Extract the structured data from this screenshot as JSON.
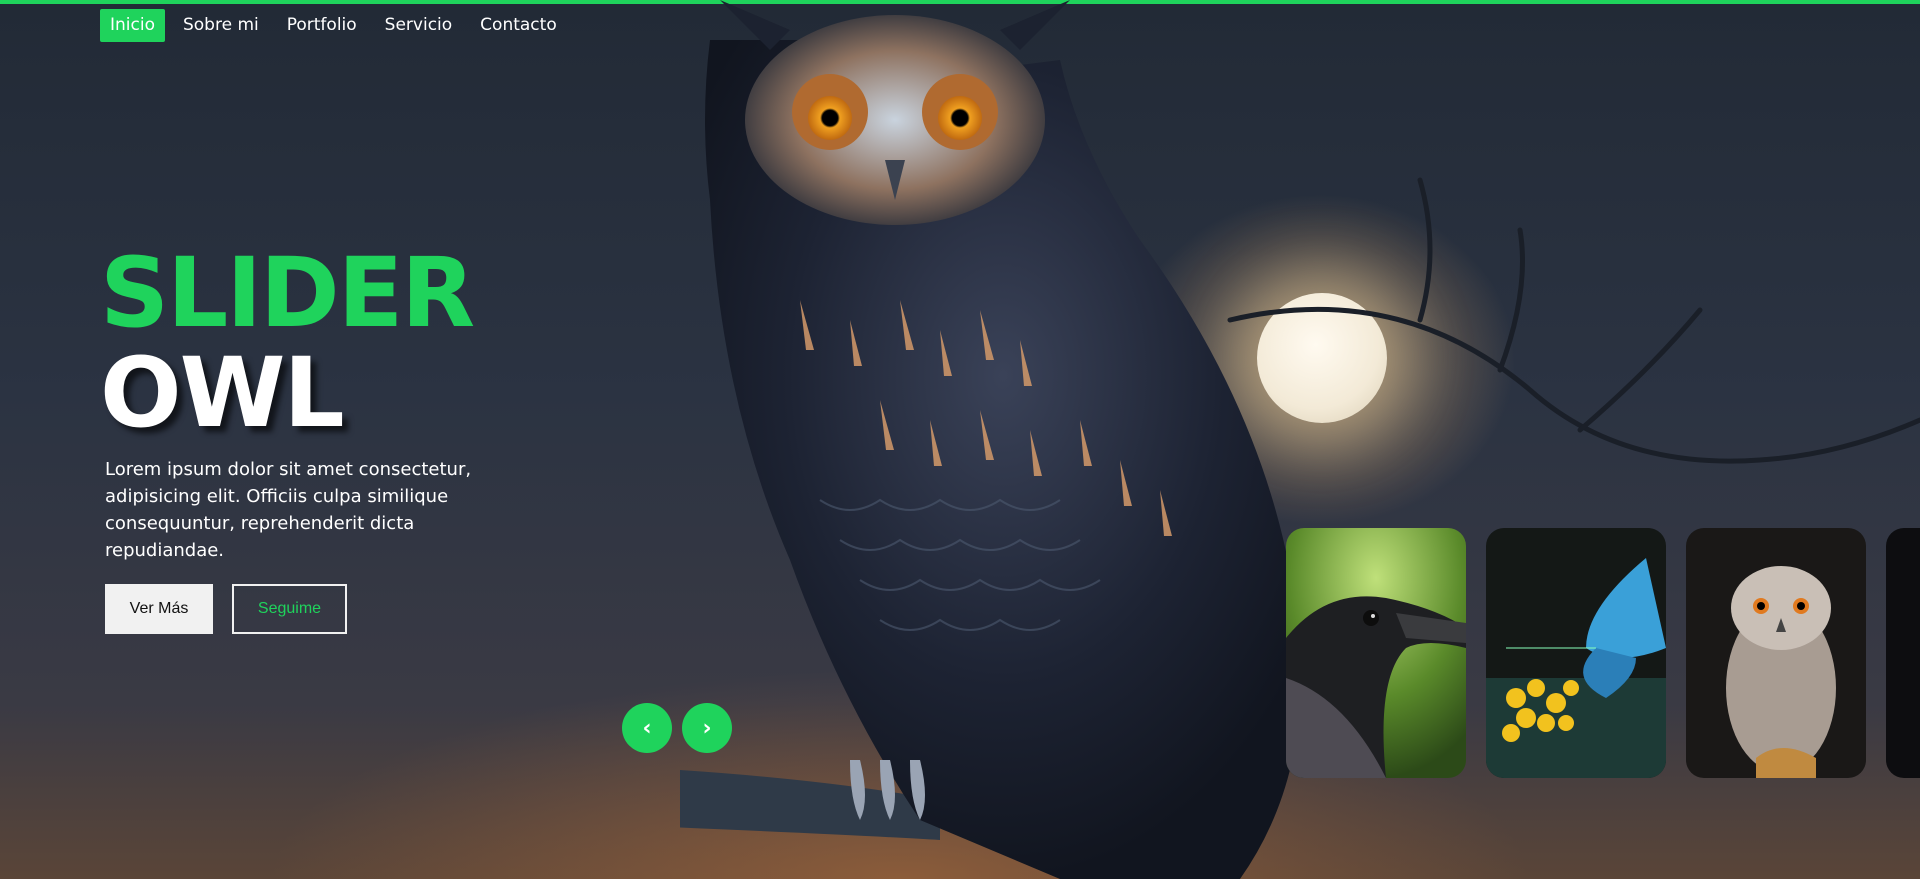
{
  "nav": {
    "items": [
      {
        "label": "Inicio",
        "active": true
      },
      {
        "label": "Sobre mi"
      },
      {
        "label": "Portfolio"
      },
      {
        "label": "Servicio"
      },
      {
        "label": "Contacto"
      }
    ]
  },
  "hero": {
    "title_line1": "SLIDER",
    "title_line2": "OWL",
    "description": "Lorem ipsum dolor sit amet consectetur, adipisicing elit. Officiis culpa similique consequuntur, reprehenderit dicta repudiandae.",
    "primary_button": "Ver Más",
    "secondary_button": "Seguime"
  },
  "slider": {
    "prev_icon": "chevron-left-icon",
    "next_icon": "chevron-right-icon",
    "prev_glyph": "‹",
    "next_glyph": "›"
  },
  "thumbnails": [
    {
      "subject": "crow"
    },
    {
      "subject": "blue-butterfly"
    },
    {
      "subject": "owl"
    },
    {
      "subject": "partial"
    }
  ],
  "colors": {
    "accent": "#1fd35c",
    "text": "#ffffff",
    "button_light": "#f1f1f1"
  }
}
